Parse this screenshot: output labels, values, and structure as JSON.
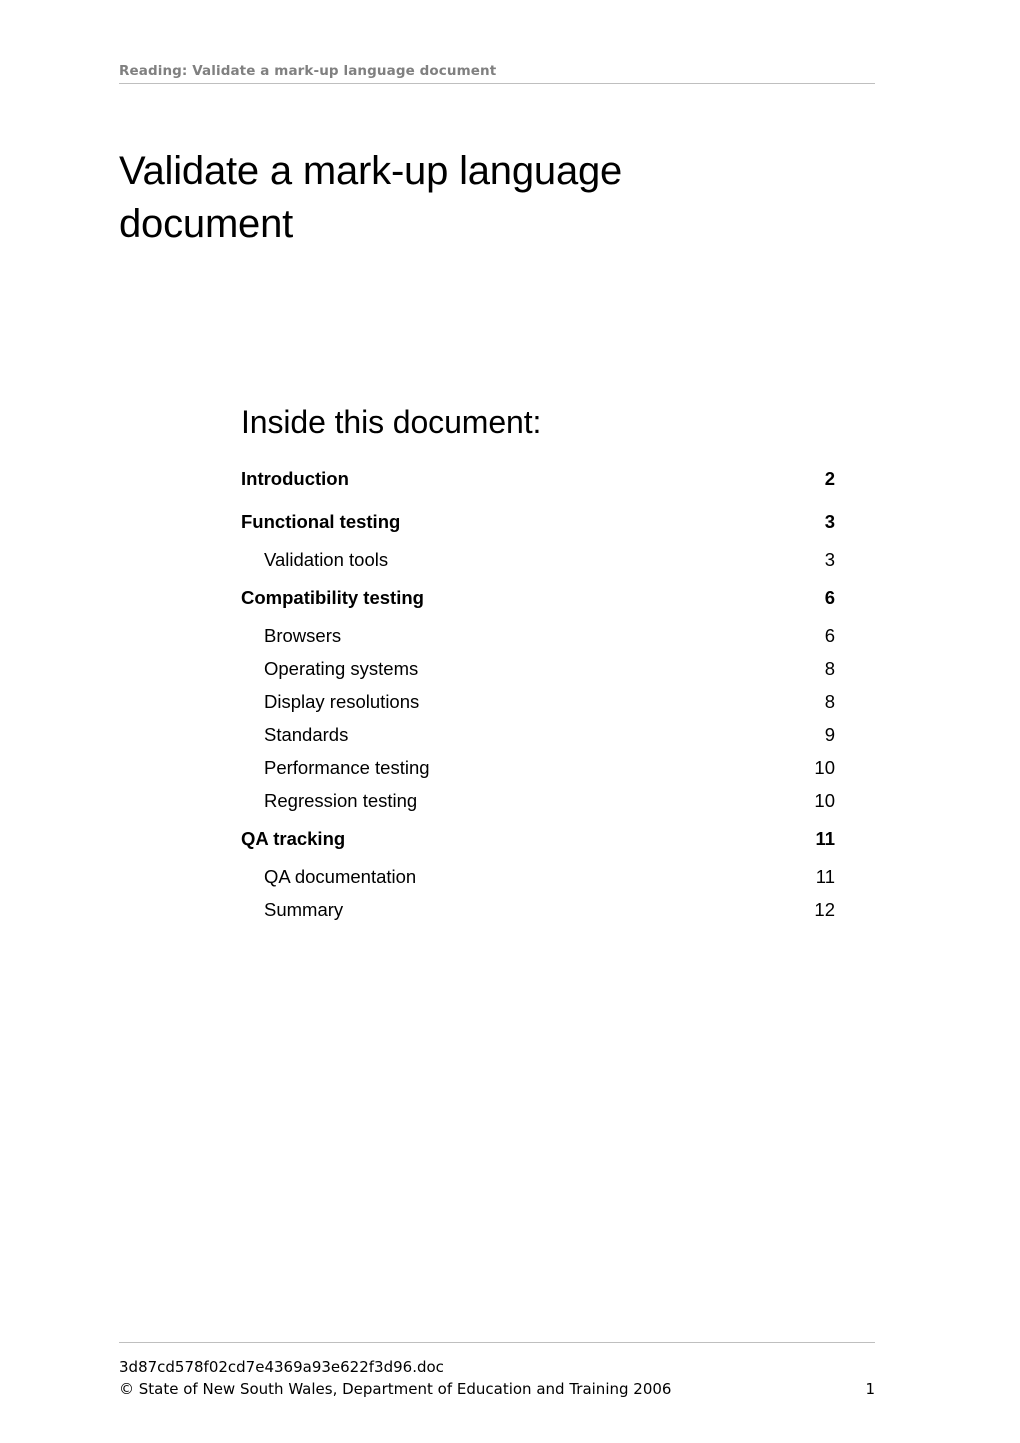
{
  "header": {
    "running_head": "Reading: Validate a mark-up language document"
  },
  "title": "Validate a mark-up language document",
  "toc": {
    "heading": "Inside this document:",
    "entries": [
      {
        "label": "Introduction",
        "page": "2",
        "level": 1
      },
      {
        "label": "Functional testing",
        "page": "3",
        "level": 1
      },
      {
        "label": "Validation tools",
        "page": "3",
        "level": 2
      },
      {
        "label": "Compatibility testing",
        "page": "6",
        "level": 1
      },
      {
        "label": "Browsers",
        "page": "6",
        "level": 2
      },
      {
        "label": "Operating systems",
        "page": "8",
        "level": 2
      },
      {
        "label": "Display resolutions",
        "page": "8",
        "level": 2
      },
      {
        "label": "Standards",
        "page": "9",
        "level": 2
      },
      {
        "label": "Performance testing",
        "page": "10",
        "level": 2
      },
      {
        "label": "Regression testing",
        "page": "10",
        "level": 2
      },
      {
        "label": "QA tracking",
        "page": "11",
        "level": 1
      },
      {
        "label": "QA documentation",
        "page": "11",
        "level": 2
      },
      {
        "label": "Summary",
        "page": "12",
        "level": 2
      }
    ]
  },
  "footer": {
    "filename": "3d87cd578f02cd7e4369a93e622f3d96.doc",
    "copyright": "© State of New South Wales, Department of Education and Training 2006",
    "page_number": "1"
  },
  "colors": {
    "header_text": "#808080",
    "rule": "#bfbfbf",
    "body_text": "#000000"
  }
}
